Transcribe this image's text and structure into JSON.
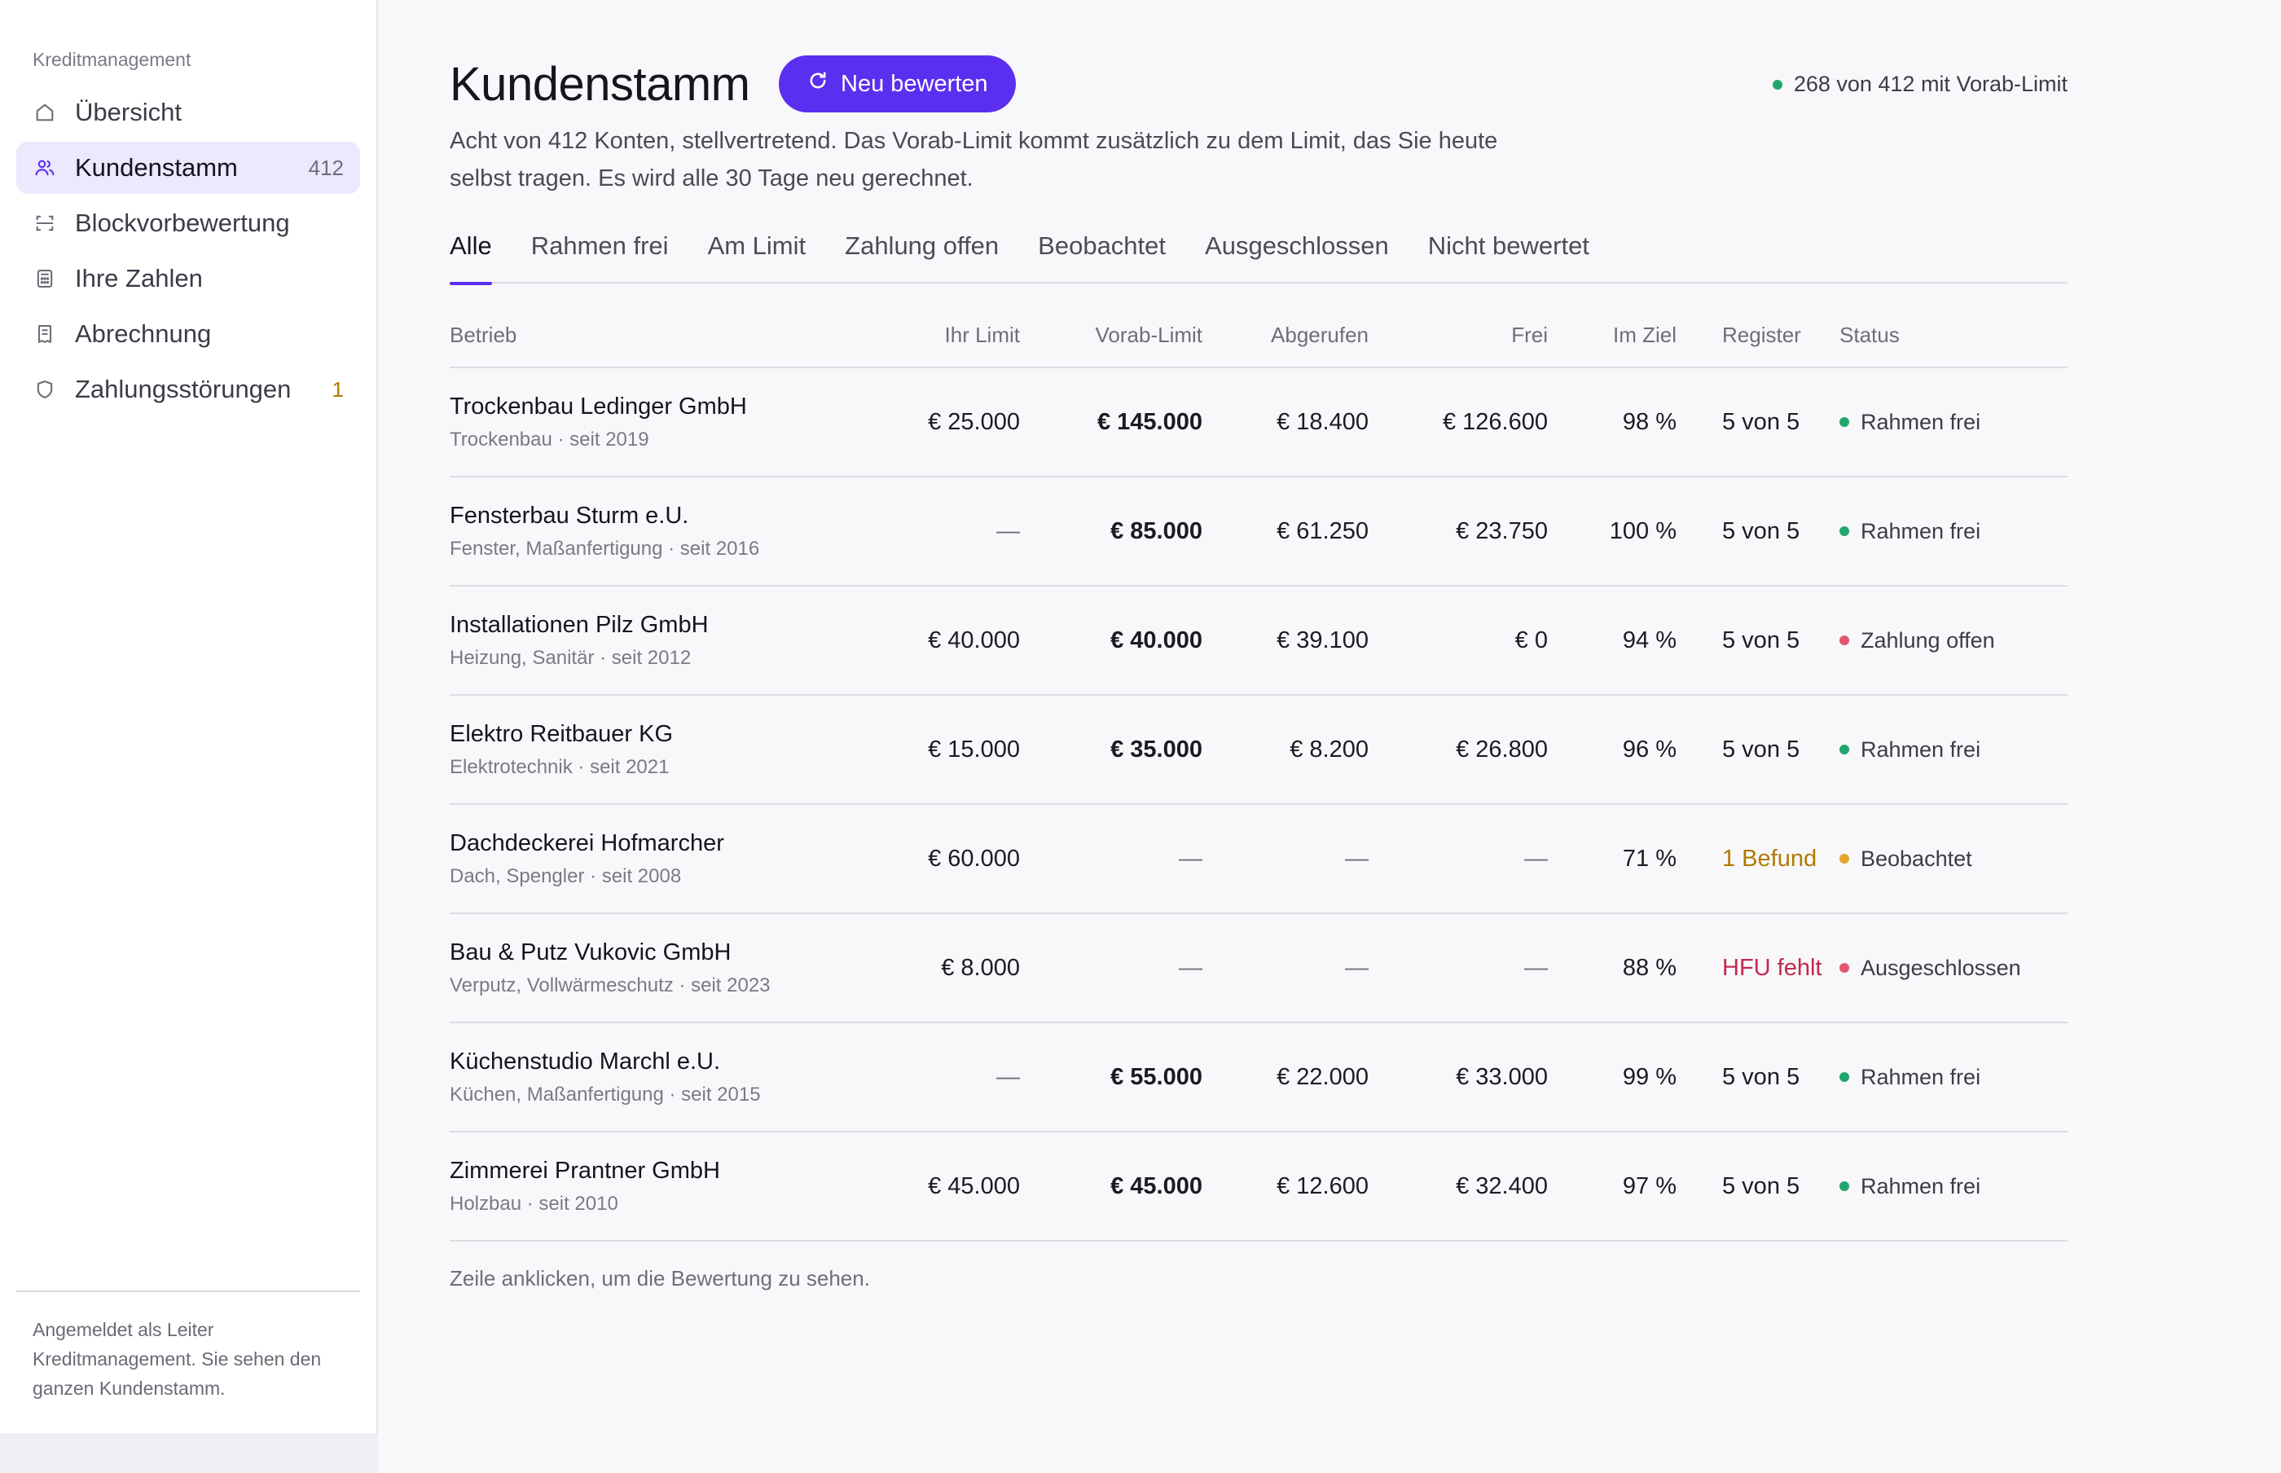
{
  "sidebar": {
    "section_label": "Kreditmanagement",
    "items": [
      {
        "label": "Übersicht",
        "icon": "home-icon",
        "count": ""
      },
      {
        "label": "Kundenstamm",
        "icon": "users-icon",
        "count": "412"
      },
      {
        "label": "Blockvorbewertung",
        "icon": "scan-icon",
        "count": ""
      },
      {
        "label": "Ihre Zahlen",
        "icon": "calculator-icon",
        "count": ""
      },
      {
        "label": "Abrechnung",
        "icon": "receipt-icon",
        "count": ""
      },
      {
        "label": "Zahlungsstörungen",
        "icon": "shield-icon",
        "count": "1"
      }
    ],
    "footer": "Angemeldet als Leiter Kreditmanagement. Sie sehen den ganzen Kundenstamm."
  },
  "header": {
    "title": "Kundenstamm",
    "button_label": "Neu bewerten",
    "vorab_indicator": "268 von 412 mit Vorab-Limit",
    "subtitle": "Acht von 412 Konten, stellvertretend. Das Vorab-Limit kommt zusätzlich zu dem Limit, das Sie heute selbst tragen. Es wird alle 30 Tage neu gerechnet."
  },
  "tabs": [
    "Alle",
    "Rahmen frei",
    "Am Limit",
    "Zahlung offen",
    "Beobachtet",
    "Ausgeschlossen",
    "Nicht bewertet"
  ],
  "table": {
    "columns": [
      "Betrieb",
      "Ihr Limit",
      "Vorab-Limit",
      "Abgerufen",
      "Frei",
      "Im Ziel",
      "Register",
      "Status"
    ],
    "rows": [
      {
        "name": "Trockenbau Ledinger GmbH",
        "meta": "Trockenbau · seit 2019",
        "limit": "€ 25.000",
        "vorab": "€ 145.000",
        "abgerufen": "€ 18.400",
        "frei": "€ 126.600",
        "ziel": "98 %",
        "register": "5 von 5",
        "status": "Rahmen frei"
      },
      {
        "name": "Fensterbau Sturm e.U.",
        "meta": "Fenster, Maßanfertigung · seit 2016",
        "limit": "—",
        "vorab": "€ 85.000",
        "abgerufen": "€ 61.250",
        "frei": "€ 23.750",
        "ziel": "100 %",
        "register": "5 von 5",
        "status": "Rahmen frei"
      },
      {
        "name": "Installationen Pilz GmbH",
        "meta": "Heizung, Sanitär · seit 2012",
        "limit": "€ 40.000",
        "vorab": "€ 40.000",
        "abgerufen": "€ 39.100",
        "frei": "€ 0",
        "ziel": "94 %",
        "register": "5 von 5",
        "status": "Zahlung offen"
      },
      {
        "name": "Elektro Reitbauer KG",
        "meta": "Elektrotechnik · seit 2021",
        "limit": "€ 15.000",
        "vorab": "€ 35.000",
        "abgerufen": "€ 8.200",
        "frei": "€ 26.800",
        "ziel": "96 %",
        "register": "5 von 5",
        "status": "Rahmen frei"
      },
      {
        "name": "Dachdeckerei Hofmarcher",
        "meta": "Dach, Spengler · seit 2008",
        "limit": "€ 60.000",
        "vorab": "—",
        "abgerufen": "—",
        "frei": "—",
        "ziel": "71 %",
        "register": "1 Befund",
        "status": "Beobachtet"
      },
      {
        "name": "Bau & Putz Vukovic GmbH",
        "meta": "Verputz, Vollwärmeschutz · seit 2023",
        "limit": "€ 8.000",
        "vorab": "—",
        "abgerufen": "—",
        "frei": "—",
        "ziel": "88 %",
        "register": "HFU fehlt",
        "status": "Ausgeschlossen"
      },
      {
        "name": "Küchenstudio Marchl e.U.",
        "meta": "Küchen, Maßanfertigung · seit 2015",
        "limit": "—",
        "vorab": "€ 55.000",
        "abgerufen": "€ 22.000",
        "frei": "€ 33.000",
        "ziel": "99 %",
        "register": "5 von 5",
        "status": "Rahmen frei"
      },
      {
        "name": "Zimmerei Prantner GmbH",
        "meta": "Holzbau · seit 2010",
        "limit": "€ 45.000",
        "vorab": "€ 45.000",
        "abgerufen": "€ 12.600",
        "frei": "€ 32.400",
        "ziel": "97 %",
        "register": "5 von 5",
        "status": "Rahmen frei"
      }
    ],
    "hint": "Zeile anklicken, um die Bewertung zu sehen."
  },
  "colors": {
    "accent": "#5b2ff0",
    "active_nav_bg": "#ece8fd",
    "status_green": "#23a66d",
    "status_red": "#e0566f",
    "status_amber": "#e3a52a",
    "register_amber": "#b07a00",
    "register_red": "#c22a4e"
  }
}
